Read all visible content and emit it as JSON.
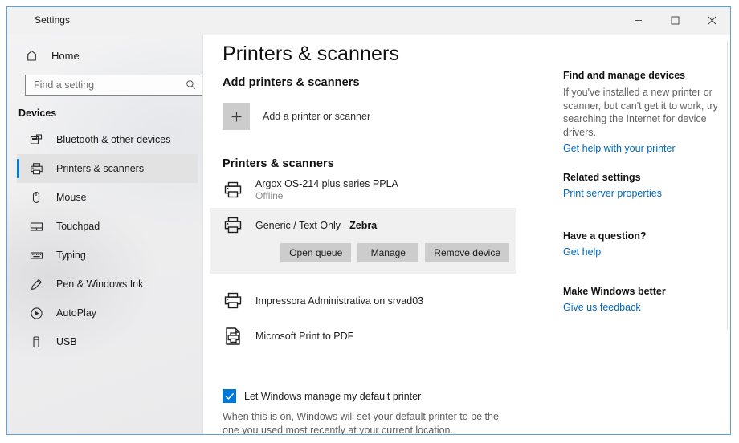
{
  "window": {
    "title": "Settings",
    "controls": {
      "minimize": "minimize",
      "maximize": "maximize",
      "close": "close"
    }
  },
  "sidebar": {
    "home_label": "Home",
    "search": {
      "placeholder": "Find a setting",
      "value": "Find a setting",
      "icon": "search-icon"
    },
    "group_header": "Devices",
    "items": [
      {
        "label": "Bluetooth & other devices",
        "icon": "bluetooth-devices-icon",
        "selected": false
      },
      {
        "label": "Printers & scanners",
        "icon": "printer-icon",
        "selected": true
      },
      {
        "label": "Mouse",
        "icon": "mouse-icon",
        "selected": false
      },
      {
        "label": "Touchpad",
        "icon": "touchpad-icon",
        "selected": false
      },
      {
        "label": "Typing",
        "icon": "keyboard-icon",
        "selected": false
      },
      {
        "label": "Pen & Windows Ink",
        "icon": "pen-icon",
        "selected": false
      },
      {
        "label": "AutoPlay",
        "icon": "autoplay-icon",
        "selected": false
      },
      {
        "label": "USB",
        "icon": "usb-icon",
        "selected": false
      }
    ]
  },
  "main": {
    "page_title": "Printers & scanners",
    "add_section": {
      "header": "Add printers & scanners",
      "button_label": "Add a printer or scanner",
      "plus_icon": "plus-icon"
    },
    "list_section": {
      "header": "Printers & scanners",
      "printers": [
        {
          "name": "Argox OS-214 plus series PPLA",
          "status": "Offline",
          "icon": "printer-icon",
          "selected": false,
          "name_suffix": ""
        },
        {
          "name": "Generic / Text Only  -  ",
          "name_suffix": "Zebra",
          "status": "",
          "icon": "printer-icon",
          "selected": true,
          "actions": [
            "Open queue",
            "Manage",
            "Remove device"
          ]
        },
        {
          "name": "Impressora Administrativa on srvad03",
          "status": "",
          "icon": "printer-icon",
          "selected": false,
          "name_suffix": ""
        },
        {
          "name": "Microsoft Print to PDF",
          "status": "",
          "icon": "print-to-pdf-icon",
          "selected": false,
          "name_suffix": ""
        }
      ]
    },
    "default_printer": {
      "checkbox_label": "Let Windows manage my default printer",
      "checked": true,
      "description": "When this is on, Windows will set your default printer to be the one you used most recently at your current location."
    }
  },
  "rail": {
    "sections": [
      {
        "title": "Find and manage devices",
        "body": "If you've installed a new printer or scanner, but can't get it to work, try searching the Internet for device drivers.",
        "link": "Get help with your printer"
      },
      {
        "title": "Related settings",
        "body": "",
        "link": "Print server properties"
      },
      {
        "title": "Have a question?",
        "body": "",
        "link": "Get help"
      },
      {
        "title": "Make Windows better",
        "body": "",
        "link": "Give us feedback"
      }
    ]
  },
  "annotation": {
    "arrow": "curved-arrow-pointing-to-manage-button",
    "color": "#1f8ae0"
  },
  "colors": {
    "accent": "#0078d7",
    "link": "#0067c0",
    "selected_row": "#f0f0f0",
    "button": "#cccccc"
  }
}
